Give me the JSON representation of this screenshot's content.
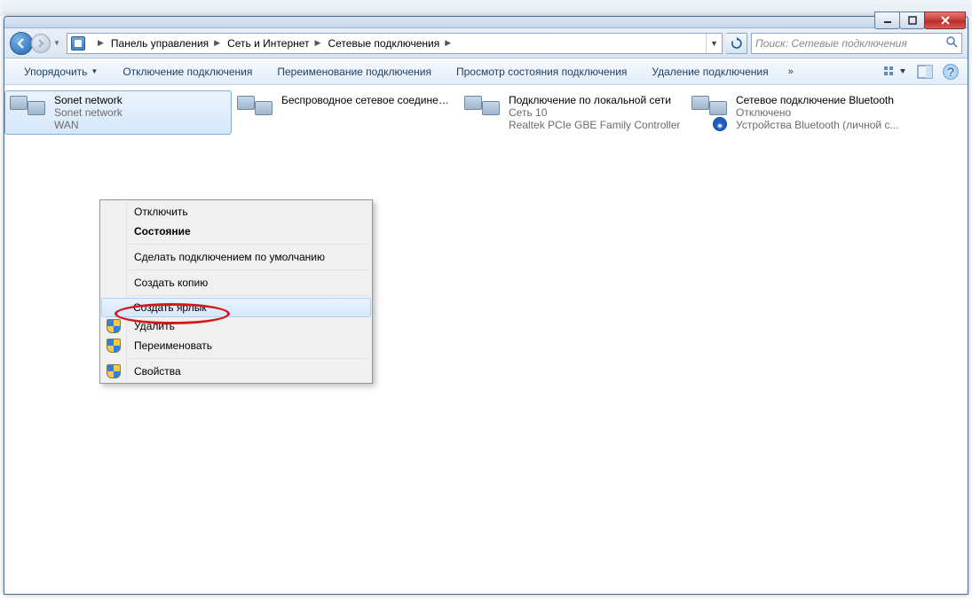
{
  "breadcrumb": {
    "parts": [
      "Панель управления",
      "Сеть и Интернет",
      "Сетевые подключения"
    ]
  },
  "search": {
    "placeholder": "Поиск: Сетевые подключения"
  },
  "toolbar": {
    "organize": "Упорядочить",
    "disable": "Отключение подключения",
    "rename": "Переименование подключения",
    "status": "Просмотр состояния подключения",
    "delete": "Удаление подключения"
  },
  "connections": [
    {
      "name": "Sonet network",
      "line2": "Sonet network",
      "line3": "WAN",
      "selected": true,
      "subicon": "link"
    },
    {
      "name": "Беспроводное сетевое соединение",
      "line2": "",
      "line3": "",
      "selected": false,
      "subicon": "wifi"
    },
    {
      "name": "Подключение по локальной сети",
      "line2": "Сеть 10",
      "line3": "Realtek PCIe GBE Family Controller",
      "selected": false,
      "subicon": "plug"
    },
    {
      "name": "Сетевое подключение Bluetooth",
      "line2": "Отключено",
      "line3": "Устройства Bluetooth (личной с...",
      "selected": false,
      "subicon": "bt"
    }
  ],
  "contextMenu": {
    "items": [
      {
        "label": "Отключить",
        "bold": false,
        "shield": false,
        "sepAfter": false
      },
      {
        "label": "Состояние",
        "bold": true,
        "shield": false,
        "sepAfter": true
      },
      {
        "label": "Сделать подключением по умолчанию",
        "bold": false,
        "shield": false,
        "sepAfter": true
      },
      {
        "label": "Создать копию",
        "bold": false,
        "shield": false,
        "sepAfter": true
      },
      {
        "label": "Создать ярлык",
        "bold": false,
        "shield": false,
        "sepAfter": false,
        "hover": true
      },
      {
        "label": "Удалить",
        "bold": false,
        "shield": true,
        "sepAfter": false
      },
      {
        "label": "Переименовать",
        "bold": false,
        "shield": true,
        "sepAfter": true
      },
      {
        "label": "Свойства",
        "bold": false,
        "shield": true,
        "sepAfter": false
      }
    ]
  }
}
